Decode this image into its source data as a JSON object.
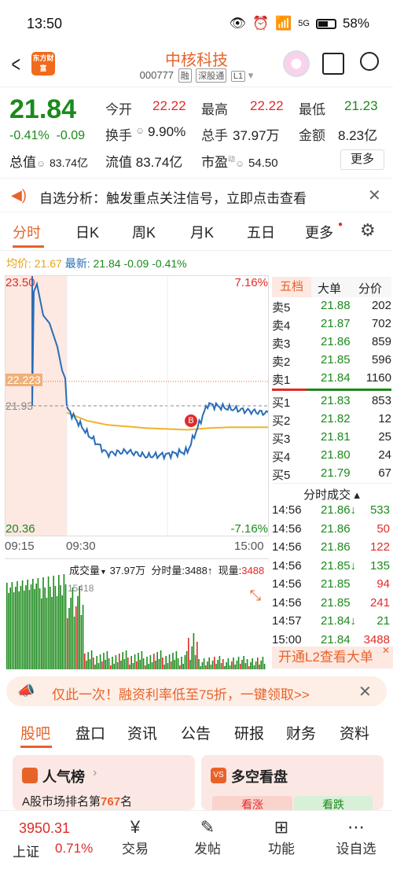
{
  "status": {
    "time": "13:50",
    "battery": "58%",
    "signal": "5G"
  },
  "header": {
    "logo": "东方财富",
    "title": "中核科技",
    "code": "000777",
    "tags": [
      "融",
      "深股通",
      "L1"
    ]
  },
  "quote": {
    "price": "21.84",
    "change_pct": "-0.41%",
    "change": "-0.09",
    "open_label": "今开",
    "open": "22.22",
    "high_label": "最高",
    "high": "22.22",
    "low_label": "最低",
    "low": "21.23",
    "turnover_label": "换手",
    "turnover": "9.90%",
    "volume_label": "总手",
    "volume": "37.97万",
    "amount_label": "金额",
    "amount": "8.23亿",
    "mktcap_label": "总值",
    "mktcap": "83.74亿",
    "float_label": "流值",
    "float": "83.74亿",
    "pe_label": "市盈",
    "pe_sup": "动",
    "pe": "54.50",
    "more": "更多"
  },
  "notice": {
    "text": "自选分析：触发重点关注信号，立即点击查看"
  },
  "tabs": [
    "分时",
    "日K",
    "周K",
    "月K",
    "五日",
    "更多"
  ],
  "info_line": {
    "avg_label": "均价:",
    "avg": "21.67",
    "last_label": "最新:",
    "last": "21.84",
    "chg": "-0.09",
    "pct": "-0.41%"
  },
  "chart": {
    "ymax": "23.50",
    "ymin": "20.36",
    "pmax": "7.16%",
    "pmin": "-7.16%",
    "ref_price": "21.93",
    "mark_price": "22.223",
    "marker": "B",
    "times": [
      "09:15",
      "09:30",
      "15:00"
    ],
    "vol_label": "成交量",
    "vol_total": "37.97万",
    "vol_min_label": "分时量:",
    "vol_min": "3488",
    "cur_label": "现量:",
    "cur": "3488",
    "vol_max": "15418"
  },
  "chart_data": {
    "type": "line",
    "x": [
      "09:30",
      "09:45",
      "10:00",
      "10:30",
      "11:00",
      "11:30",
      "13:00",
      "13:30",
      "14:00",
      "14:30",
      "15:00"
    ],
    "series": [
      {
        "values": [
          21.9,
          21.6,
          21.35,
          21.38,
          21.32,
          21.34,
          21.38,
          21.95,
          21.9,
          21.87,
          21.84
        ]
      },
      {
        "values": [
          21.85,
          21.75,
          21.7,
          21.68,
          21.66,
          21.65,
          21.64,
          21.66,
          21.67,
          21.67,
          21.67
        ]
      }
    ],
    "ylim": [
      20.36,
      23.5
    ]
  },
  "orderbook": {
    "tabs": [
      "五档",
      "大单",
      "分价"
    ],
    "asks": [
      {
        "label": "卖5",
        "price": "21.88",
        "vol": "202"
      },
      {
        "label": "卖4",
        "price": "21.87",
        "vol": "702"
      },
      {
        "label": "卖3",
        "price": "21.86",
        "vol": "859"
      },
      {
        "label": "卖2",
        "price": "21.85",
        "vol": "596"
      },
      {
        "label": "卖1",
        "price": "21.84",
        "vol": "1160"
      }
    ],
    "bids": [
      {
        "label": "买1",
        "price": "21.83",
        "vol": "853"
      },
      {
        "label": "买2",
        "price": "21.82",
        "vol": "12"
      },
      {
        "label": "买3",
        "price": "21.81",
        "vol": "25"
      },
      {
        "label": "买4",
        "price": "21.80",
        "vol": "24"
      },
      {
        "label": "买5",
        "price": "21.79",
        "vol": "67"
      }
    ],
    "trades_title": "分时成交",
    "trades": [
      {
        "t": "14:56",
        "p": "21.86↓",
        "v": "533",
        "c": "green"
      },
      {
        "t": "14:56",
        "p": "21.86",
        "v": "50",
        "c": "red"
      },
      {
        "t": "14:56",
        "p": "21.86",
        "v": "122",
        "c": "red"
      },
      {
        "t": "14:56",
        "p": "21.85↓",
        "v": "135",
        "c": "green"
      },
      {
        "t": "14:56",
        "p": "21.85",
        "v": "94",
        "c": "red"
      },
      {
        "t": "14:56",
        "p": "21.85",
        "v": "241",
        "c": "red"
      },
      {
        "t": "14:57",
        "p": "21.84↓",
        "v": "21",
        "c": "green"
      },
      {
        "t": "15:00",
        "p": "21.84",
        "v": "3488",
        "c": "red"
      }
    ],
    "l2": "开通L2查看大单"
  },
  "banner": {
    "text": "仅此一次！融资利率低至75折，一键领取>>"
  },
  "bottom_tabs": [
    "股吧",
    "盘口",
    "资讯",
    "公告",
    "研报",
    "财务",
    "资料"
  ],
  "cards": {
    "popular_title": "人气榜",
    "popular_sub_prefix": "A股市场排名第",
    "popular_rank": "767",
    "popular_sub_suffix": "名",
    "vs_title": "多空看盘",
    "bull": "看涨",
    "bear": "看跌"
  },
  "nav": {
    "index_value": "3950.31",
    "index_name": "上证",
    "index_pct": "0.71%",
    "items": [
      "交易",
      "发帖",
      "功能",
      "设自选"
    ]
  }
}
